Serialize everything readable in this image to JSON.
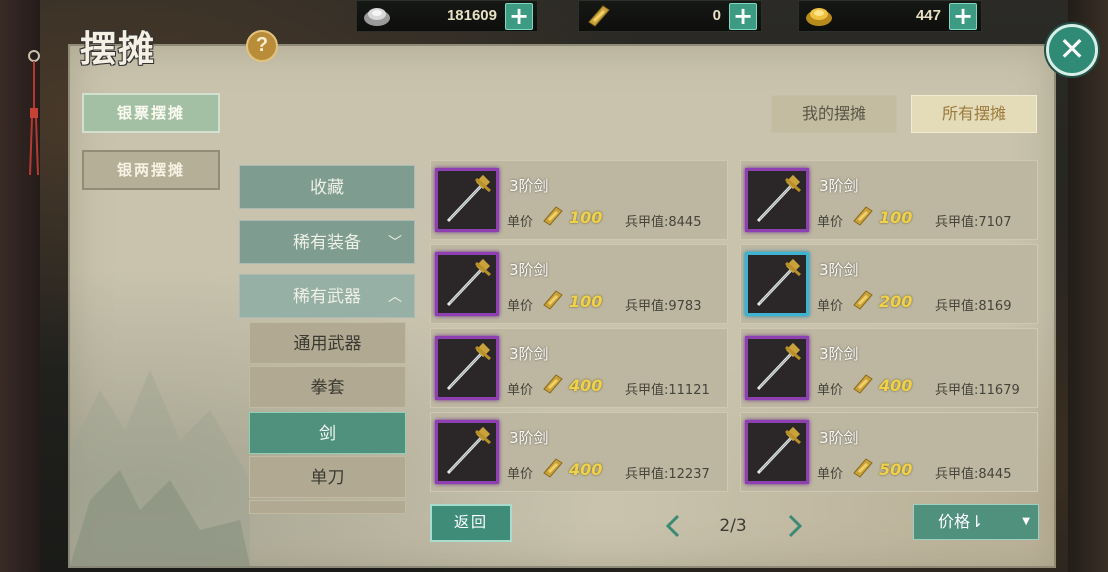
{
  "currencies": [
    {
      "amount": "181609",
      "icon": "silver-ingot-icon"
    },
    {
      "amount": "0",
      "icon": "gold-bar-icon"
    },
    {
      "amount": "447",
      "icon": "gold-ingot-icon"
    }
  ],
  "plus_label": "+",
  "title": "摆摊",
  "help_label": "?",
  "close_label": "✕",
  "side_tabs": [
    {
      "label": "银票摆摊",
      "active": true
    },
    {
      "label": "银两摆摊",
      "active": false
    }
  ],
  "top_tabs": [
    {
      "label": "我的摆摊",
      "active": false
    },
    {
      "label": "所有摆摊",
      "active": true
    }
  ],
  "categories": [
    {
      "label": "收藏"
    },
    {
      "label": "稀有装备",
      "chevron": "﹀"
    },
    {
      "label": "稀有武器",
      "chevron": "︿"
    }
  ],
  "subcategories": [
    {
      "label": "通用武器"
    },
    {
      "label": "拳套"
    },
    {
      "label": "剑",
      "active": true
    },
    {
      "label": "单刀"
    }
  ],
  "price_label": "单价",
  "items": [
    {
      "name": "3阶剑",
      "price": "100",
      "armor": "兵甲值:8445",
      "frame": "purple"
    },
    {
      "name": "3阶剑",
      "price": "100",
      "armor": "兵甲值:7107",
      "frame": "purple"
    },
    {
      "name": "3阶剑",
      "price": "100",
      "armor": "兵甲值:9783",
      "frame": "purple"
    },
    {
      "name": "3阶剑",
      "price": "200",
      "armor": "兵甲值:8169",
      "frame": "blue"
    },
    {
      "name": "3阶剑",
      "price": "400",
      "armor": "兵甲值:11121",
      "frame": "purple"
    },
    {
      "name": "3阶剑",
      "price": "400",
      "armor": "兵甲值:11679",
      "frame": "purple"
    },
    {
      "name": "3阶剑",
      "price": "400",
      "armor": "兵甲值:12237",
      "frame": "purple"
    },
    {
      "name": "3阶剑",
      "price": "500",
      "armor": "兵甲值:8445",
      "frame": "purple"
    }
  ],
  "back_label": "返回",
  "page": "2/3",
  "sort_label": "价格⇂",
  "colors": {
    "accent": "#4f917c",
    "panel": "#c9c3ad",
    "frame_purple": "#8e3fb1",
    "frame_blue": "#3fb4d2",
    "price_gold": "#efd24a"
  }
}
